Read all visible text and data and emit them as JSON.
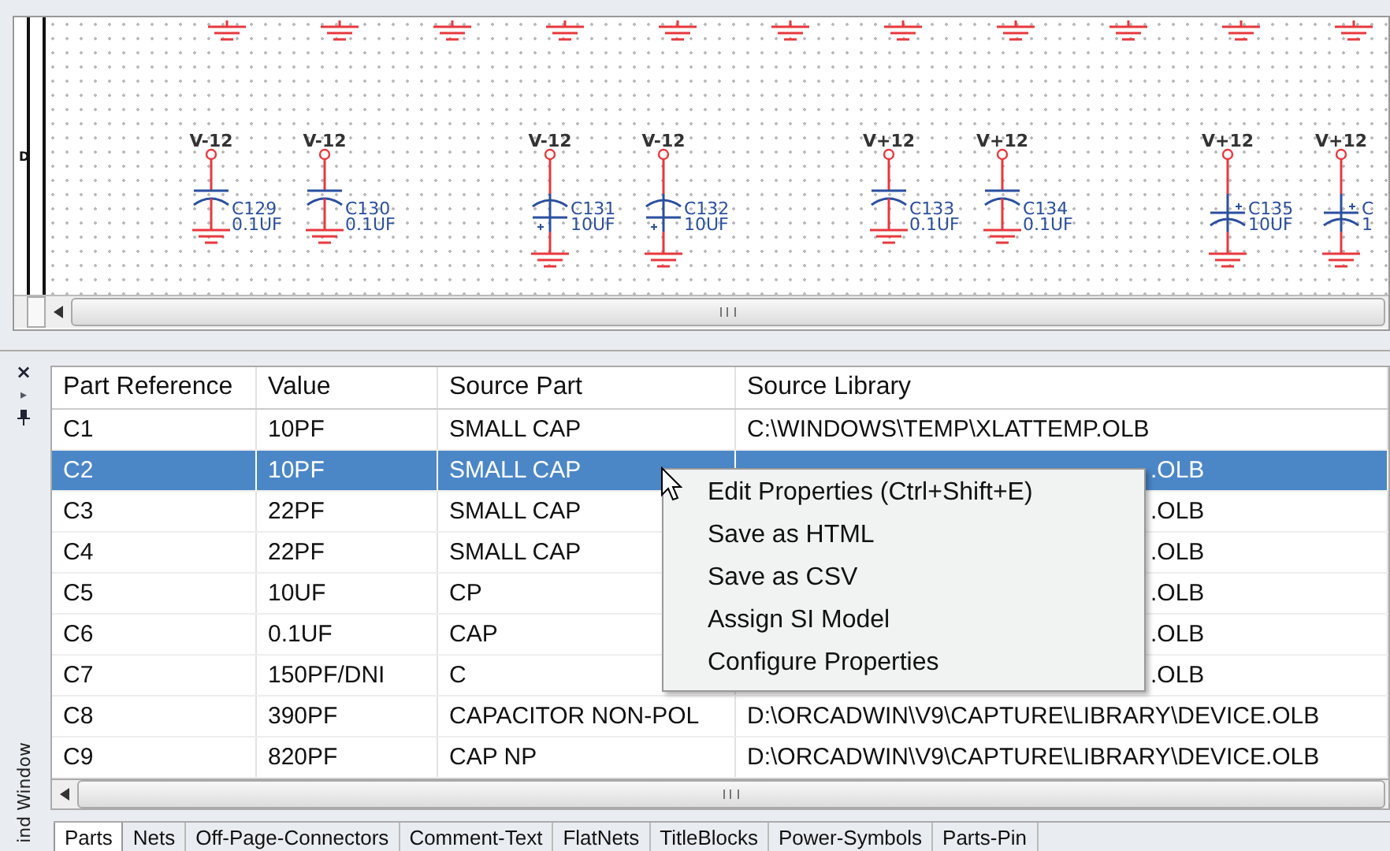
{
  "schematic": {
    "zone_label": "D",
    "parts": [
      {
        "kind": "ceramic",
        "net": "V-12",
        "ref": "C129",
        "value": "0.1UF"
      },
      {
        "kind": "ceramic",
        "net": "V-12",
        "ref": "C130",
        "value": "0.1UF"
      },
      {
        "kind": "electrolytic-down",
        "net": "V-12",
        "ref": "C131",
        "value": "10UF"
      },
      {
        "kind": "electrolytic-down",
        "net": "V-12",
        "ref": "C132",
        "value": "10UF"
      },
      {
        "kind": "ceramic",
        "net": "V+12",
        "ref": "C133",
        "value": "0.1UF"
      },
      {
        "kind": "ceramic",
        "net": "V+12",
        "ref": "C134",
        "value": "0.1UF"
      },
      {
        "kind": "electrolytic-up",
        "net": "V+12",
        "ref": "C135",
        "value": "10UF"
      },
      {
        "kind": "electrolytic-up",
        "net": "V+12",
        "ref": "C",
        "value": "1"
      }
    ]
  },
  "side_strip": {
    "close": "×",
    "expand": "▸",
    "title": "ind Window"
  },
  "table": {
    "columns": [
      "Part Reference",
      "Value",
      "Source Part",
      "Source Library"
    ],
    "rows": [
      {
        "ref": "C1",
        "value": "10PF",
        "part": "SMALL CAP",
        "library": "C:\\WINDOWS\\TEMP\\XLATTEMP.OLB",
        "selected": false,
        "covered": false
      },
      {
        "ref": "C2",
        "value": "10PF",
        "part": "SMALL CAP",
        "library": ".OLB",
        "selected": true,
        "covered": true
      },
      {
        "ref": "C3",
        "value": "22PF",
        "part": "SMALL CAP",
        "library": ".OLB",
        "selected": false,
        "covered": true
      },
      {
        "ref": "C4",
        "value": "22PF",
        "part": "SMALL CAP",
        "library": ".OLB",
        "selected": false,
        "covered": true
      },
      {
        "ref": "C5",
        "value": "10UF",
        "part": "CP",
        "library": ".OLB",
        "selected": false,
        "covered": true
      },
      {
        "ref": "C6",
        "value": "0.1UF",
        "part": "CAP",
        "library": ".OLB",
        "selected": false,
        "covered": true
      },
      {
        "ref": "C7",
        "value": "150PF/DNI",
        "part": "C",
        "library": ".OLB",
        "selected": false,
        "covered": true
      },
      {
        "ref": "C8",
        "value": "390PF",
        "part": "CAPACITOR NON-POL",
        "library": "D:\\ORCADWIN\\V9\\CAPTURE\\LIBRARY\\DEVICE.OLB",
        "selected": false,
        "covered": false
      },
      {
        "ref": "C9",
        "value": "820PF",
        "part": "CAP NP",
        "library": "D:\\ORCADWIN\\V9\\CAPTURE\\LIBRARY\\DEVICE.OLB",
        "selected": false,
        "covered": false
      }
    ]
  },
  "context_menu": [
    "Edit Properties (Ctrl+Shift+E)",
    "Save as HTML",
    "Save as CSV",
    "Assign SI Model",
    "Configure Properties"
  ],
  "tabs": [
    {
      "label": "Parts",
      "selected": true
    },
    {
      "label": "Nets",
      "selected": false
    },
    {
      "label": "Off-Page-Connectors",
      "selected": false
    },
    {
      "label": "Comment-Text",
      "selected": false
    },
    {
      "label": "FlatNets",
      "selected": false
    },
    {
      "label": "TitleBlocks",
      "selected": false
    },
    {
      "label": "Power-Symbols",
      "selected": false
    },
    {
      "label": "Parts-Pin",
      "selected": false
    }
  ]
}
